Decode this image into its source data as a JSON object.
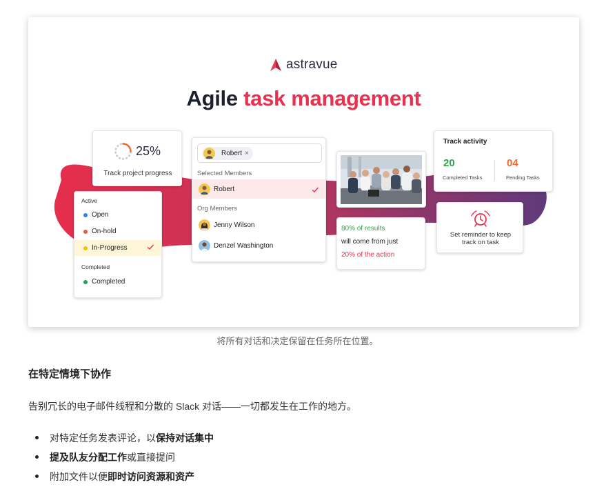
{
  "brand": {
    "name": "astravue"
  },
  "headline": {
    "prefix": "Agile",
    "accent": "task management"
  },
  "colors": {
    "accent": "#e8304f",
    "dark": "#1c1f2e",
    "green": "#2aa745",
    "orange": "#f26b2a"
  },
  "progress_card": {
    "percent_text": "25%",
    "progress_fraction": 0.25,
    "label": "Track project progress"
  },
  "status_card": {
    "active_heading": "Active",
    "items": [
      {
        "label": "Open",
        "color": "#2f80ed"
      },
      {
        "label": "On-hold",
        "color": "#eb5a3c"
      },
      {
        "label": "In-Progress",
        "color": "#f2c200",
        "selected": true
      }
    ],
    "completed_heading": "Completed",
    "completed_item": {
      "label": "Completed",
      "color": "#22a55a"
    }
  },
  "members_card": {
    "chip_label": "Robert",
    "chip_remove": "×",
    "selected_heading": "Selected  Members",
    "selected": [
      {
        "name": "Robert"
      }
    ],
    "org_heading": "Org Members",
    "org": [
      {
        "name": "Jenny Wilson"
      },
      {
        "name": "Denzel Washington"
      }
    ]
  },
  "quote_card": {
    "line1": "80% of results",
    "line2": "will come from just",
    "line3": "20% of the action"
  },
  "activity_card": {
    "title": "Track activity",
    "completed_count": "20",
    "completed_label": "Completed Tasks",
    "pending_count": "04",
    "pending_label": "Pending Tasks"
  },
  "reminder_card": {
    "line1": "Set reminder to keep",
    "line2": "track on task"
  },
  "caption": "将所有对话和决定保留在任务所在位置。",
  "section": {
    "title": "在特定情境下协作",
    "paragraph": "告别冗长的电子邮件线程和分散的 Slack 对话——一切都发生在工作的地方。",
    "bullets": [
      {
        "pre": "对特定任务发表评论，以",
        "bold": "保持对话集中",
        "post": ""
      },
      {
        "pre": "",
        "bold": "提及队友分配工作",
        "post": "或直接提问"
      },
      {
        "pre": "附加文件以便",
        "bold": "即时访问资源和资产",
        "post": ""
      }
    ]
  }
}
